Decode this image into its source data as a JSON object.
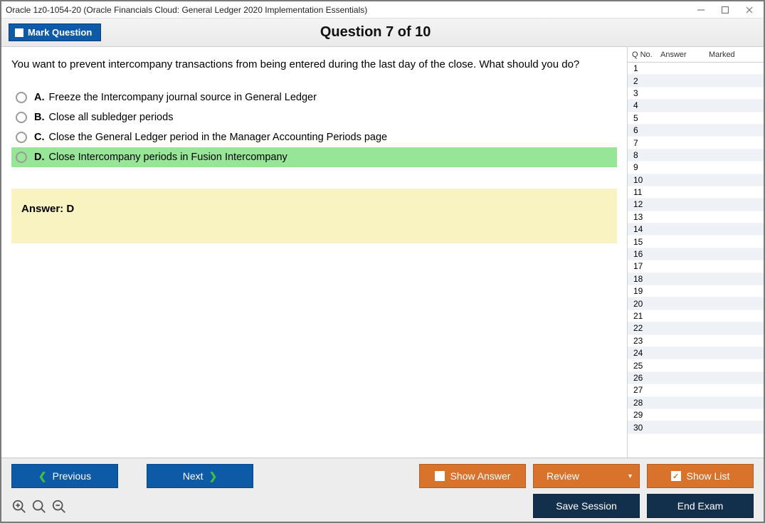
{
  "window": {
    "title": "Oracle 1z0-1054-20 (Oracle Financials Cloud: General Ledger 2020 Implementation Essentials)"
  },
  "header": {
    "mark_label": "Mark Question",
    "counter": "Question 7 of 10"
  },
  "question": {
    "text": "You want to prevent intercompany transactions from being entered during the last day of the close. What should you do?",
    "options": [
      {
        "letter": "A.",
        "text": "Freeze the Intercompany journal source in General Ledger",
        "highlight": false
      },
      {
        "letter": "B.",
        "text": "Close all subledger periods",
        "highlight": false
      },
      {
        "letter": "C.",
        "text": "Close the General Ledger period in the Manager Accounting Periods page",
        "highlight": false
      },
      {
        "letter": "D.",
        "text": "Close Intercompany periods in Fusion Intercompany",
        "highlight": true
      }
    ],
    "answer_label": "Answer: D"
  },
  "side": {
    "headers": {
      "qno": "Q No.",
      "answer": "Answer",
      "marked": "Marked"
    },
    "count": 30
  },
  "buttons": {
    "previous": "Previous",
    "next": "Next",
    "show_answer": "Show Answer",
    "review": "Review",
    "show_list": "Show List",
    "save_session": "Save Session",
    "end_exam": "End Exam"
  }
}
